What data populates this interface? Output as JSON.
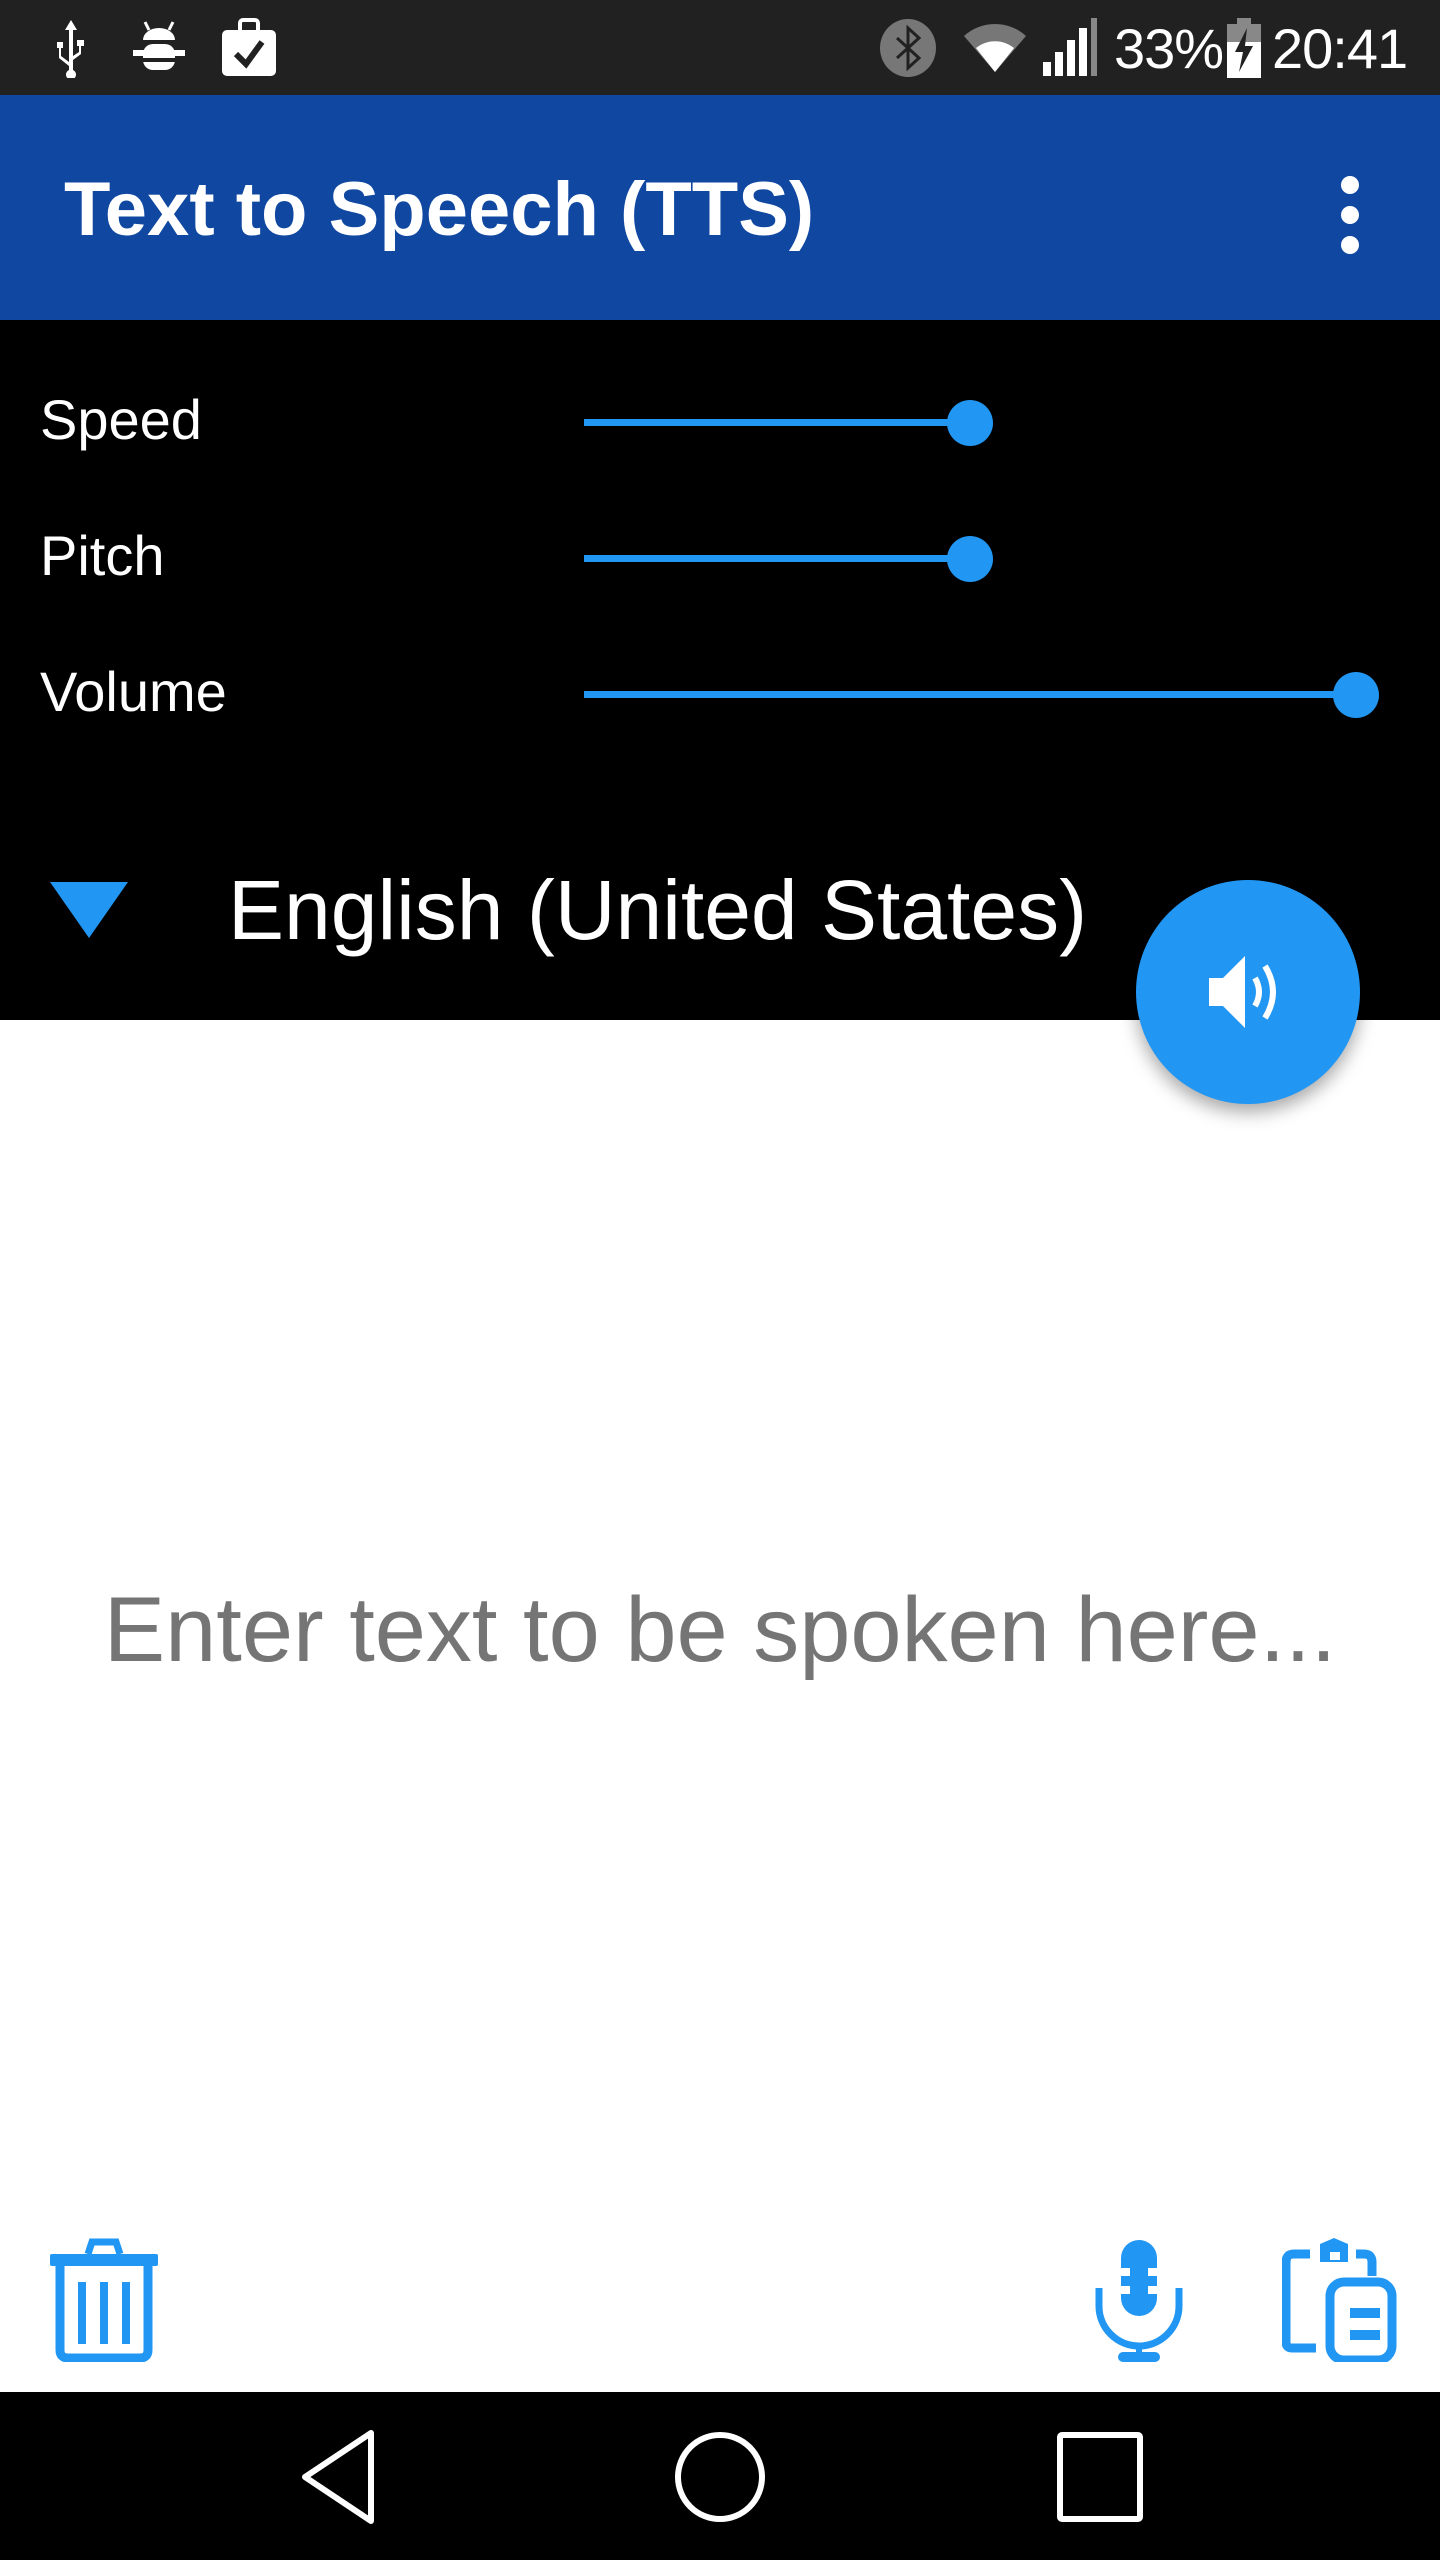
{
  "status_bar": {
    "left_icons": [
      "usb-icon",
      "android-debug-icon",
      "clipboard-check-icon"
    ],
    "right_icons": [
      "bluetooth-icon",
      "wifi-icon",
      "signal-icon",
      "battery-charging-icon"
    ],
    "battery_percent": "33%",
    "time": "20:41"
  },
  "app_bar": {
    "title": "Text to Speech (TTS)",
    "overflow_icon": "more-vert-icon"
  },
  "controls": {
    "sliders": [
      {
        "label": "Speed",
        "value": 0.5
      },
      {
        "label": "Pitch",
        "value": 0.5
      },
      {
        "label": "Volume",
        "value": 1.0
      }
    ],
    "language": {
      "selected": "English (United States)",
      "icon": "dropdown-triangle-icon"
    },
    "accent_color": "#2196F3"
  },
  "fab": {
    "icon": "speaker-icon",
    "action": "speak"
  },
  "editor": {
    "value": "",
    "placeholder": "Enter text to be spoken here..."
  },
  "bottom_actions": [
    {
      "name": "clear",
      "icon": "trash-icon"
    },
    {
      "name": "voice-input",
      "icon": "microphone-icon"
    },
    {
      "name": "paste",
      "icon": "clipboard-paste-icon"
    }
  ],
  "nav_bar": {
    "buttons": [
      "back",
      "home",
      "recents"
    ]
  },
  "colors": {
    "app_bar": "#0F47A1",
    "status_bar": "#212121",
    "accent": "#2196F3",
    "placeholder": "#757575"
  }
}
